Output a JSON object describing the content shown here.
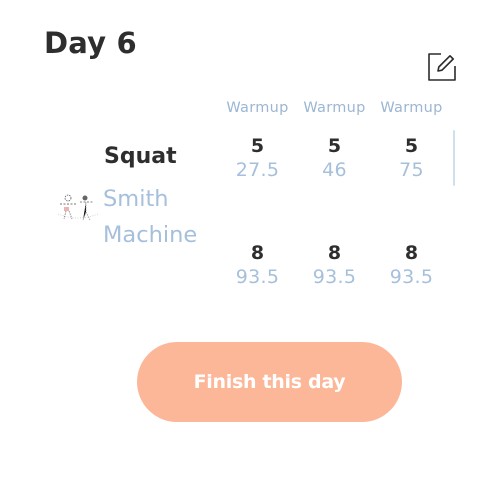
{
  "header": {
    "title": "Day 6",
    "edit_icon": "edit-note-icon"
  },
  "sets_header": [
    "Warmup",
    "Warmup",
    "Warmup"
  ],
  "exercise": {
    "name": "Squat",
    "variant": "Smith Machine",
    "image_icon": "exercise-illustration",
    "rows": [
      {
        "sets": [
          {
            "reps": "5",
            "weight": "27.5"
          },
          {
            "reps": "5",
            "weight": "46"
          },
          {
            "reps": "5",
            "weight": "75"
          }
        ]
      },
      {
        "sets": [
          {
            "reps": "8",
            "weight": "93.5"
          },
          {
            "reps": "8",
            "weight": "93.5"
          },
          {
            "reps": "8",
            "weight": "93.5"
          }
        ]
      }
    ]
  },
  "footer": {
    "finish_label": "Finish this day"
  },
  "colors": {
    "accent": "#fbb798",
    "muted_blue": "#a6c0dc",
    "text": "#2e2e2e"
  }
}
